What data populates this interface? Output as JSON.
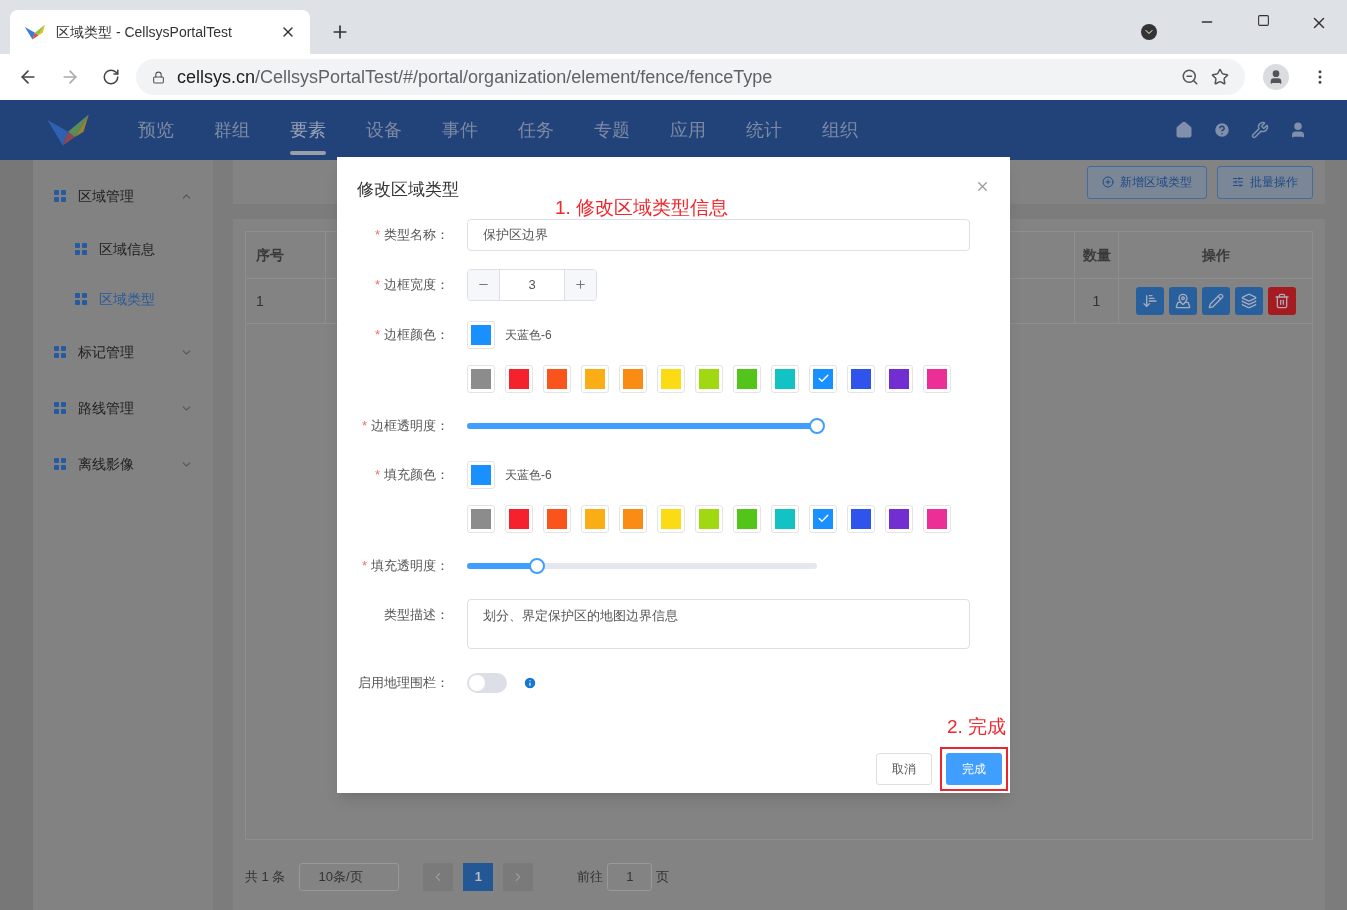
{
  "browser": {
    "tab_title": "区域类型 - CellsysPortalTest",
    "url_host": "cellsys.cn",
    "url_path": "/CellsysPortalTest/#/portal/organization/element/fence/fenceType"
  },
  "nav": {
    "items": [
      {
        "label": "预览",
        "selected": false
      },
      {
        "label": "群组",
        "selected": false
      },
      {
        "label": "要素",
        "selected": true
      },
      {
        "label": "设备",
        "selected": false
      },
      {
        "label": "事件",
        "selected": false
      },
      {
        "label": "任务",
        "selected": false
      },
      {
        "label": "专题",
        "selected": false
      },
      {
        "label": "应用",
        "selected": false
      },
      {
        "label": "统计",
        "selected": false
      },
      {
        "label": "组织",
        "selected": false
      }
    ]
  },
  "sidebar": {
    "items": [
      {
        "label": "区域管理",
        "expanded": true,
        "children": [
          {
            "label": "区域信息",
            "selected": false
          },
          {
            "label": "区域类型",
            "selected": true
          }
        ]
      },
      {
        "label": "标记管理",
        "expanded": false
      },
      {
        "label": "路线管理",
        "expanded": false
      },
      {
        "label": "离线影像",
        "expanded": false
      }
    ]
  },
  "toolbar": {
    "buttons": [
      {
        "kind": "add",
        "label": "新增区域类型"
      },
      {
        "kind": "batch",
        "label": "批量操作"
      }
    ]
  },
  "table": {
    "columns": [
      {
        "label": "序号"
      },
      {
        "label": "数量"
      },
      {
        "label": "操作"
      }
    ],
    "rows": [
      {
        "index": "1",
        "count": "1"
      }
    ]
  },
  "pagination": {
    "total": "共 1 条",
    "page_size": "10条/页",
    "pages": [
      {
        "label": "1",
        "selected": true
      }
    ],
    "goto_label": "前往",
    "goto_value": "1",
    "goto_suffix": "页"
  },
  "dialog": {
    "title": "修改区域类型",
    "annotation": "1. 修改区域类型信息",
    "fields": [
      {
        "kind": "text",
        "label": "类型名称：",
        "required_mark": "*",
        "value": "保护区边界"
      },
      {
        "kind": "stepper",
        "label": "边框宽度：",
        "required_mark": "*",
        "value": "3"
      },
      {
        "kind": "color",
        "label": "边框颜色：",
        "required_mark": "*",
        "value": "天蓝色-6",
        "swatches": [
          {
            "color": "#8c8c8c",
            "selected": false
          },
          {
            "color": "#f5222d",
            "selected": false
          },
          {
            "color": "#fa541c",
            "selected": false
          },
          {
            "color": "#faad14",
            "selected": false
          },
          {
            "color": "#fa8c16",
            "selected": false
          },
          {
            "color": "#fadb14",
            "selected": false
          },
          {
            "color": "#a0d911",
            "selected": false
          },
          {
            "color": "#52c41a",
            "selected": false
          },
          {
            "color": "#13c2c2",
            "selected": false
          },
          {
            "color": "#1890ff",
            "selected": true
          },
          {
            "color": "#2f54eb",
            "selected": false
          },
          {
            "color": "#722ed1",
            "selected": false
          },
          {
            "color": "#eb2f96",
            "selected": false
          }
        ]
      },
      {
        "kind": "slider",
        "label": "边框透明度：",
        "required_mark": "*",
        "level": 1
      },
      {
        "kind": "color",
        "label": "填充颜色：",
        "required_mark": "*",
        "value": "天蓝色-6",
        "swatches": [
          {
            "color": "#8c8c8c",
            "selected": false
          },
          {
            "color": "#f5222d",
            "selected": false
          },
          {
            "color": "#fa541c",
            "selected": false
          },
          {
            "color": "#faad14",
            "selected": false
          },
          {
            "color": "#fa8c16",
            "selected": false
          },
          {
            "color": "#fadb14",
            "selected": false
          },
          {
            "color": "#a0d911",
            "selected": false
          },
          {
            "color": "#52c41a",
            "selected": false
          },
          {
            "color": "#13c2c2",
            "selected": false
          },
          {
            "color": "#1890ff",
            "selected": true
          },
          {
            "color": "#2f54eb",
            "selected": false
          },
          {
            "color": "#722ed1",
            "selected": false
          },
          {
            "color": "#eb2f96",
            "selected": false
          }
        ]
      },
      {
        "kind": "slider",
        "label": "填充透明度：",
        "required_mark": "*",
        "level": 0.2
      },
      {
        "kind": "textarea",
        "label": "类型描述：",
        "value": "划分、界定保护区的地图边界信息"
      },
      {
        "kind": "switch",
        "label": "启用地理围栏：",
        "on": false
      }
    ],
    "annotation_2": "2. 完成",
    "buttons": [
      {
        "kind": "cancel",
        "label": "取消"
      },
      {
        "kind": "primary",
        "label": "完成"
      }
    ]
  }
}
